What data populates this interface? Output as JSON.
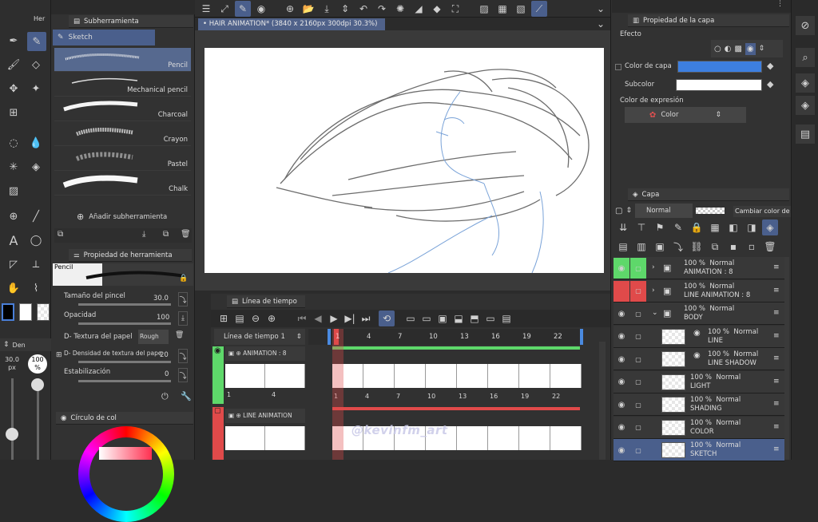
{
  "tool_panel": {
    "sub_tool_title": "Subherramienta",
    "sub_tool_tab_cut": "Her",
    "brush_group": "Sketch",
    "brushes": [
      {
        "label": "Pencil",
        "selected": true
      },
      {
        "label": "Mechanical pencil",
        "selected": false
      },
      {
        "label": "Charcoal",
        "selected": false
      },
      {
        "label": "Crayon",
        "selected": false
      },
      {
        "label": "Pastel",
        "selected": false
      },
      {
        "label": "Chalk",
        "selected": false
      }
    ],
    "add_subtool": "Añadir subherramienta",
    "tool_property_title": "Propiedad de herramienta",
    "tool_preview_label": "Pencil",
    "brush_size_label": "Tamaño del pincel",
    "brush_size_value": "30.0",
    "opacity_label": "Opacidad",
    "opacity_value": "100",
    "paper_texture_label": "D- Textura del papel",
    "paper_texture_value": "Rough pap",
    "texture_density_label": "D- Densidad de textura del pape",
    "texture_density_value": "20",
    "stabilization_label": "Estabilización",
    "stabilization_value": "0",
    "color_circle_title": "Círculo de col",
    "size_indicator": "30.0\npx",
    "size_indicator_top": "30.0",
    "size_indicator_unit": "px",
    "opacity_indicator": "100",
    "opacity_indicator_unit": "%",
    "den_tab": "Den"
  },
  "canvas": {
    "tab_title": "HAIR ANIMATION* (3840 x 2160px 300dpi 30.3%)"
  },
  "timeline": {
    "title": "Línea de tiempo",
    "timeline_name": "Línea de tiempo 1",
    "frame_numbers": [
      "1",
      "4",
      "7",
      "10",
      "13",
      "16",
      "19",
      "22"
    ],
    "track_animation": "ANIMATION : 8",
    "track_line_animation": "LINE ANIMATION",
    "cell_numbers_track1": [
      "1",
      "4"
    ],
    "cell_numbers_main": [
      "1",
      "4",
      "7",
      "10",
      "13",
      "16",
      "19",
      "22"
    ],
    "watermark": "@kevinfm_art"
  },
  "layer_property": {
    "title": "Propiedad de la capa",
    "effect_label": "Efecto",
    "layer_color_label": "Color de capa",
    "subcolor_label": "Subcolor",
    "expression_color_label": "Color de expresión",
    "expression_color_value": "Color",
    "layer_color_hex": "#3d7fe0",
    "subcolor_hex": "#ffffff"
  },
  "layer_panel": {
    "title": "Capa",
    "blend_mode": "Normal",
    "tooltip": "Cambiar color de capa",
    "layers": [
      {
        "pct": "100 %",
        "mode": "Normal",
        "name": "ANIMATION : 8",
        "type": "folder-anim",
        "color": "green"
      },
      {
        "pct": "100 %",
        "mode": "Normal",
        "name": "LINE ANIMATION : 8",
        "type": "folder-anim",
        "color": "red"
      },
      {
        "pct": "100 %",
        "mode": "Normal",
        "name": "BODY",
        "type": "folder",
        "color": ""
      },
      {
        "pct": "100 %",
        "mode": "Normal",
        "name": "LINE",
        "type": "layer",
        "color": ""
      },
      {
        "pct": "100 %",
        "mode": "Normal",
        "name": "LINE SHADOW",
        "type": "layer",
        "color": ""
      },
      {
        "pct": "100 %",
        "mode": "Normal",
        "name": "LIGHT",
        "type": "layer",
        "color": ""
      },
      {
        "pct": "100 %",
        "mode": "Normal",
        "name": "SHADING",
        "type": "layer",
        "color": ""
      },
      {
        "pct": "100 %",
        "mode": "Normal",
        "name": "COLOR",
        "type": "layer",
        "color": ""
      },
      {
        "pct": "100 %",
        "mode": "Normal",
        "name": "SKETCH",
        "type": "layer",
        "color": "",
        "selected": true
      }
    ]
  },
  "colors": {
    "accent": "#4a5f8c",
    "green_track": "#5ed86a",
    "red_track": "#e04a4a",
    "layer_color": "#3d7fe0"
  }
}
